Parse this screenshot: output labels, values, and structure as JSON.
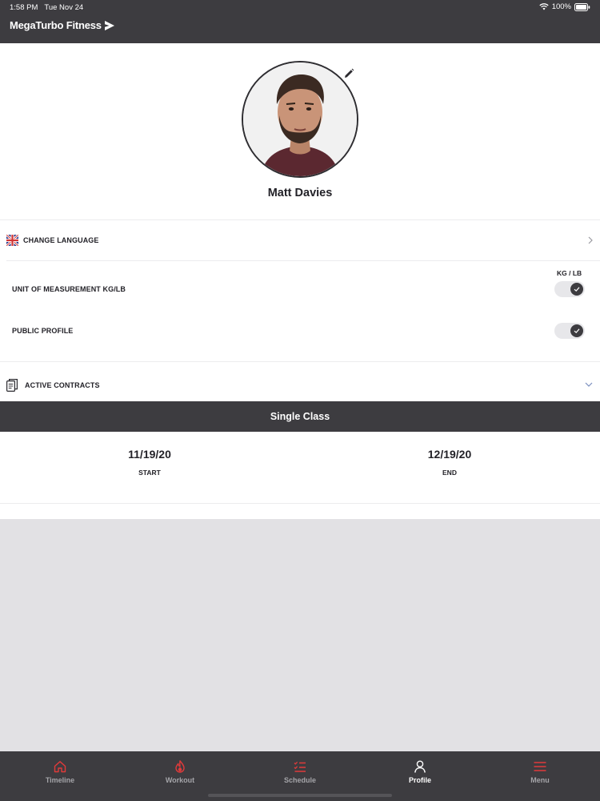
{
  "status_bar": {
    "time": "1:58 PM",
    "date": "Tue Nov 24",
    "battery": "100%"
  },
  "brand": {
    "name": "MegaTurbo Fitness"
  },
  "profile": {
    "name": "Matt Davies"
  },
  "settings": {
    "change_language": "CHANGE LANGUAGE",
    "unit_header": "KG / LB",
    "unit_label": "UNIT OF MEASUREMENT KG/LB",
    "public_profile_label": "PUBLIC PROFILE",
    "active_contracts": "ACTIVE CONTRACTS"
  },
  "contract": {
    "plan": "Single Class",
    "start_date": "11/19/20",
    "start_label": "START",
    "end_date": "12/19/20",
    "end_label": "END"
  },
  "tabs": [
    {
      "label": "Timeline",
      "icon": "home-icon"
    },
    {
      "label": "Workout",
      "icon": "flame-icon"
    },
    {
      "label": "Schedule",
      "icon": "schedule-list-icon"
    },
    {
      "label": "Profile",
      "icon": "person-icon",
      "active": true
    },
    {
      "label": "Menu",
      "icon": "hamburger-menu-icon"
    }
  ],
  "colors": {
    "bar": "#3d3c40",
    "accent": "#e03a3a",
    "background": "#e2e1e4",
    "text": "#232228"
  }
}
